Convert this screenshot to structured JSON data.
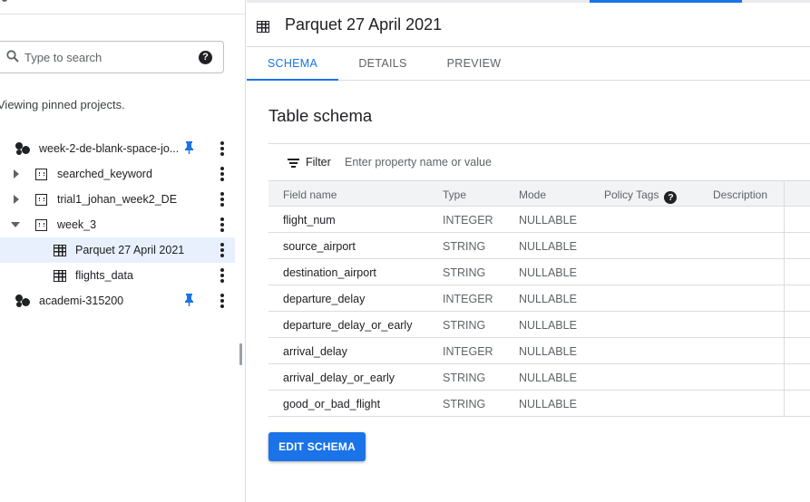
{
  "colors": {
    "accent": "#1a73e8",
    "selected_bg": "#e8f0fe",
    "header_bg": "#f1f3f4"
  },
  "explorer": {
    "search": {
      "placeholder": "Type to search",
      "icon": "search-icon",
      "help_icon": "help-icon"
    },
    "viewing_text": "Viewing pinned projects.",
    "tree": {
      "project1": {
        "label": "week-2-de-blank-space-jo...",
        "pinned": true
      },
      "dataset_searched": {
        "label": "searched_keyword"
      },
      "dataset_trial": {
        "label": "trial1_johan_week2_DE"
      },
      "dataset_week3": {
        "label": "week_3"
      },
      "table_parquet": {
        "label": "Parquet 27 April 2021",
        "selected": true
      },
      "table_flights": {
        "label": "flights_data"
      },
      "project2": {
        "label": "academi-315200",
        "pinned": true
      }
    }
  },
  "detail": {
    "title": "Parquet 27 April 2021",
    "tabs": {
      "schema": "SCHEMA",
      "details": "DETAILS",
      "preview": "PREVIEW",
      "active": "SCHEMA"
    },
    "section_title": "Table schema",
    "filter": {
      "label": "Filter",
      "placeholder": "Enter property name or value"
    },
    "columns": {
      "field_name": "Field name",
      "type": "Type",
      "mode": "Mode",
      "policy_tags": "Policy Tags",
      "description": "Description"
    },
    "rows": [
      {
        "name": "flight_num",
        "type": "INTEGER",
        "mode": "NULLABLE"
      },
      {
        "name": "source_airport",
        "type": "STRING",
        "mode": "NULLABLE"
      },
      {
        "name": "destination_airport",
        "type": "STRING",
        "mode": "NULLABLE"
      },
      {
        "name": "departure_delay",
        "type": "INTEGER",
        "mode": "NULLABLE"
      },
      {
        "name": "departure_delay_or_early",
        "type": "STRING",
        "mode": "NULLABLE"
      },
      {
        "name": "arrival_delay",
        "type": "INTEGER",
        "mode": "NULLABLE"
      },
      {
        "name": "arrival_delay_or_early",
        "type": "STRING",
        "mode": "NULLABLE"
      },
      {
        "name": "good_or_bad_flight",
        "type": "STRING",
        "mode": "NULLABLE"
      }
    ],
    "edit_button": "EDIT SCHEMA"
  }
}
